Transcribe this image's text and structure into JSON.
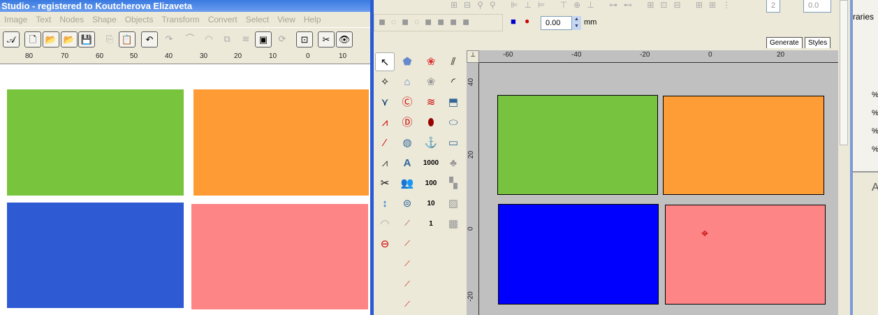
{
  "left_window": {
    "title": "Studio - registered to Koutcherova Elizaveta",
    "menu": [
      "Image",
      "Text",
      "Nodes",
      "Shape",
      "Objects",
      "Transform",
      "Convert",
      "Select",
      "View",
      "Help"
    ],
    "toolbar": [
      "text-tool",
      "new",
      "open",
      "open-alt",
      "save",
      "copy",
      "paste",
      "undo",
      "redo",
      "bezier",
      "arc",
      "clone",
      "layer",
      "preview",
      "refresh",
      "frame",
      "eye-cut",
      "eye-stitch"
    ],
    "ruler_labels": [
      "80",
      "70",
      "60",
      "50",
      "40",
      "30",
      "20",
      "10",
      "0",
      "10"
    ],
    "shapes": [
      {
        "name": "green",
        "color": "#78c43c"
      },
      {
        "name": "orange",
        "color": "#fe9b34"
      },
      {
        "name": "blue",
        "color": "#2e5bd3"
      },
      {
        "name": "pink",
        "color": "#fd8585"
      }
    ]
  },
  "right_window": {
    "offset_value": "0.00",
    "offset_unit": "mm",
    "spin_value": "2",
    "spin_value2": "0.0",
    "tabs": [
      "Generate",
      "Styles"
    ],
    "ruler_top": [
      "-60",
      "-40",
      "-20",
      "0",
      "20"
    ],
    "ruler_left": [
      "40",
      "20",
      "0",
      "-20"
    ],
    "palette_numbers": [
      "1000",
      "100",
      "10",
      "1"
    ],
    "shapes": [
      {
        "name": "green",
        "color": "#77c340"
      },
      {
        "name": "orange",
        "color": "#fe9c35"
      },
      {
        "name": "blue",
        "color": "#0000ff"
      },
      {
        "name": "pink",
        "color": "#fe8585"
      }
    ]
  },
  "side_panel": {
    "title": "raries",
    "percent": [
      "%",
      "%",
      "%",
      "%"
    ],
    "letter": "A"
  }
}
